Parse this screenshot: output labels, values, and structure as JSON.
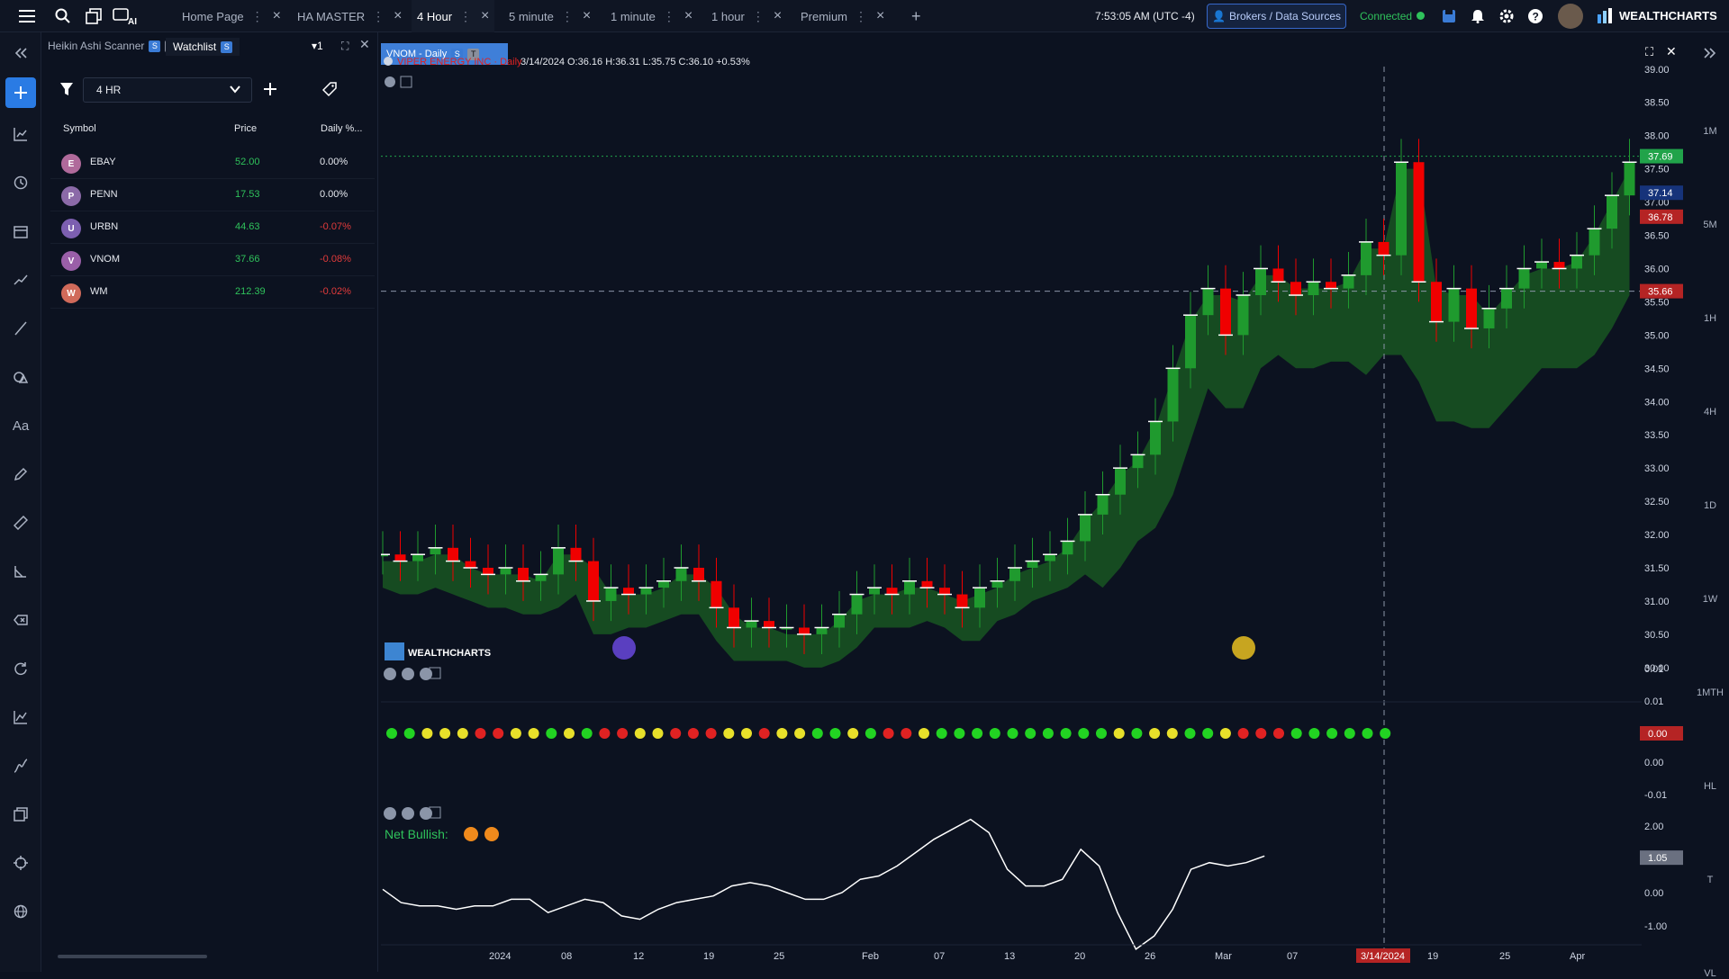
{
  "app": {
    "brand": "WEALTHCHARTS",
    "time": "7:53:05 AM",
    "timezone": "(UTC -4)",
    "brokers_label": "Brokers / Data Sources",
    "connected_label": "Connected"
  },
  "tabs": [
    {
      "label": "Home Page",
      "active": false
    },
    {
      "label": "HA MASTER",
      "active": false
    },
    {
      "label": "4 Hour",
      "active": true
    },
    {
      "label": "5 minute",
      "active": false
    },
    {
      "label": "1 minute",
      "active": false
    },
    {
      "label": "1 hour",
      "active": false
    },
    {
      "label": "Premium",
      "active": false
    }
  ],
  "panel": {
    "tab1": "Heikin Ashi Scanner",
    "tab2": "Watchlist",
    "badge_s": "S",
    "badge_t": "T",
    "count": "1",
    "timeframe": "4 HR",
    "columns": [
      "Symbol",
      "Price",
      "Daily %..."
    ],
    "rows": [
      {
        "letter": "E",
        "symbol": "EBAY",
        "price": "52.00",
        "change": "0.00%",
        "color": "#b06a9b",
        "chg_color": "#e6e9ef"
      },
      {
        "letter": "P",
        "symbol": "PENN",
        "price": "17.53",
        "change": "0.00%",
        "color": "#8b6aa8",
        "chg_color": "#e6e9ef"
      },
      {
        "letter": "U",
        "symbol": "URBN",
        "price": "44.63",
        "change": "-0.07%",
        "color": "#7c5fb0",
        "chg_color": "#e23b3b"
      },
      {
        "letter": "V",
        "symbol": "VNOM",
        "price": "37.66",
        "change": "-0.08%",
        "color": "#9a5fa8",
        "chg_color": "#e23b3b"
      },
      {
        "letter": "W",
        "symbol": "WM",
        "price": "212.39",
        "change": "-0.02%",
        "color": "#d06a5a",
        "chg_color": "#e23b3b"
      }
    ]
  },
  "chart": {
    "tab_label": "VNOM - Daily",
    "legend_name": "VIPER ENERGY INC · Daily",
    "ohlc": "3/14/2024 O:36.16 H:36.31 L:35.75 C:36.10 +0.53%",
    "watermark": "WEALTHCHARTS",
    "net_bullish": "Net Bullish:",
    "price_ticks": [
      "39.00",
      "38.50",
      "38.00",
      "37.50",
      "37.00",
      "36.50",
      "36.00",
      "35.50",
      "35.00",
      "34.50",
      "34.00",
      "33.50",
      "33.00",
      "32.50",
      "32.00",
      "31.50",
      "31.00",
      "30.50",
      "30.00"
    ],
    "price_badges": [
      {
        "v": "37.69",
        "bg": "#21a34a"
      },
      {
        "v": "37.14",
        "bg": "#16337a"
      },
      {
        "v": "36.78",
        "bg": "#b52424"
      },
      {
        "v": "35.66",
        "bg": "#b52424"
      }
    ],
    "osc1_ticks": [
      "0.01",
      "0.01",
      "0.00",
      "-0.01"
    ],
    "osc1_badge": "0.00",
    "osc2_ticks": [
      "2.00",
      "0.00",
      "-1.00"
    ],
    "osc2_badge": "1.05",
    "date_ticks": [
      "2024",
      "08",
      "12",
      "19",
      "25",
      "Feb",
      "07",
      "13",
      "20",
      "26",
      "Mar",
      "07",
      "14",
      "19",
      "25",
      "Apr"
    ],
    "crosshair_date": "3/14/2024",
    "colors": {
      "up": "#1f9a2e",
      "down": "#f00000",
      "cloud": "#1b6a22",
      "yellow": "#e8e02a",
      "red": "#e02222",
      "green": "#22d322"
    }
  },
  "timeframes": [
    "1M",
    "5M",
    "1H",
    "4H",
    "1D",
    "1W",
    "1MTH",
    "HL",
    "T",
    "VL"
  ],
  "chart_data": {
    "type": "candlestick",
    "title": "VIPER ENERGY INC · Daily",
    "ylim": [
      29.7,
      39.2
    ],
    "x": [
      "2024",
      "08",
      "12",
      "19",
      "25",
      "Feb",
      "07",
      "13",
      "20",
      "26",
      "Mar",
      "07",
      "14",
      "19",
      "25",
      "Apr"
    ],
    "candles": [
      [
        31.7,
        31.7
      ],
      [
        31.7,
        31.6
      ],
      [
        31.6,
        31.7
      ],
      [
        31.7,
        31.8
      ],
      [
        31.8,
        31.6
      ],
      [
        31.6,
        31.5
      ],
      [
        31.5,
        31.4
      ],
      [
        31.4,
        31.5
      ],
      [
        31.5,
        31.3
      ],
      [
        31.3,
        31.4
      ],
      [
        31.4,
        31.8
      ],
      [
        31.8,
        31.6
      ],
      [
        31.6,
        31.0
      ],
      [
        31.0,
        31.2
      ],
      [
        31.2,
        31.1
      ],
      [
        31.1,
        31.2
      ],
      [
        31.2,
        31.3
      ],
      [
        31.3,
        31.5
      ],
      [
        31.5,
        31.3
      ],
      [
        31.3,
        30.9
      ],
      [
        30.9,
        30.6
      ],
      [
        30.6,
        30.7
      ],
      [
        30.7,
        30.6
      ],
      [
        30.6,
        30.6
      ],
      [
        30.6,
        30.5
      ],
      [
        30.5,
        30.6
      ],
      [
        30.6,
        30.8
      ],
      [
        30.8,
        31.1
      ],
      [
        31.1,
        31.2
      ],
      [
        31.2,
        31.1
      ],
      [
        31.1,
        31.3
      ],
      [
        31.3,
        31.2
      ],
      [
        31.2,
        31.1
      ],
      [
        31.1,
        30.9
      ],
      [
        30.9,
        31.2
      ],
      [
        31.2,
        31.3
      ],
      [
        31.3,
        31.5
      ],
      [
        31.5,
        31.6
      ],
      [
        31.6,
        31.7
      ],
      [
        31.7,
        31.9
      ],
      [
        31.9,
        32.3
      ],
      [
        32.3,
        32.6
      ],
      [
        32.6,
        33.0
      ],
      [
        33.0,
        33.2
      ],
      [
        33.2,
        33.7
      ],
      [
        33.7,
        34.5
      ],
      [
        34.5,
        35.3
      ],
      [
        35.3,
        35.7
      ],
      [
        35.7,
        35.0
      ],
      [
        35.0,
        35.6
      ],
      [
        35.6,
        36.0
      ],
      [
        36.0,
        35.8
      ],
      [
        35.8,
        35.6
      ],
      [
        35.6,
        35.8
      ],
      [
        35.8,
        35.7
      ],
      [
        35.7,
        35.9
      ],
      [
        35.9,
        36.4
      ],
      [
        36.4,
        36.2
      ],
      [
        36.2,
        37.6
      ],
      [
        37.6,
        35.8
      ],
      [
        35.8,
        35.2
      ],
      [
        35.2,
        35.7
      ],
      [
        35.7,
        35.1
      ],
      [
        35.1,
        35.4
      ],
      [
        35.4,
        35.7
      ],
      [
        35.7,
        36.0
      ],
      [
        36.0,
        36.1
      ],
      [
        36.1,
        36.0
      ],
      [
        36.0,
        36.2
      ],
      [
        36.2,
        36.6
      ],
      [
        36.6,
        37.1
      ],
      [
        37.1,
        37.6
      ]
    ],
    "dots": [
      "green",
      "green",
      "yellow",
      "yellow",
      "yellow",
      "red",
      "red",
      "yellow",
      "yellow",
      "green",
      "yellow",
      "green",
      "red",
      "red",
      "yellow",
      "yellow",
      "red",
      "red",
      "red",
      "yellow",
      "yellow",
      "red",
      "yellow",
      "yellow",
      "green",
      "green",
      "yellow",
      "green",
      "red",
      "red",
      "yellow",
      "green",
      "green",
      "green",
      "green",
      "green",
      "green",
      "green",
      "green",
      "green",
      "green",
      "yellow",
      "green",
      "yellow",
      "yellow",
      "green",
      "green",
      "yellow",
      "red",
      "red",
      "red",
      "green",
      "green",
      "green",
      "green",
      "green",
      "green"
    ],
    "osc": [
      0.1,
      -0.3,
      -0.4,
      -0.4,
      -0.5,
      -0.4,
      -0.4,
      -0.2,
      -0.2,
      -0.6,
      -0.4,
      -0.2,
      -0.3,
      -0.7,
      -0.8,
      -0.5,
      -0.3,
      -0.2,
      -0.1,
      0.2,
      0.3,
      0.2,
      0.0,
      -0.2,
      -0.2,
      0.0,
      0.4,
      0.5,
      0.8,
      1.2,
      1.6,
      1.9,
      2.2,
      1.8,
      0.7,
      0.2,
      0.2,
      0.4,
      1.3,
      0.8,
      -0.6,
      -1.7,
      -1.3,
      -0.5,
      0.7,
      0.9,
      0.8,
      0.9,
      1.1
    ]
  }
}
